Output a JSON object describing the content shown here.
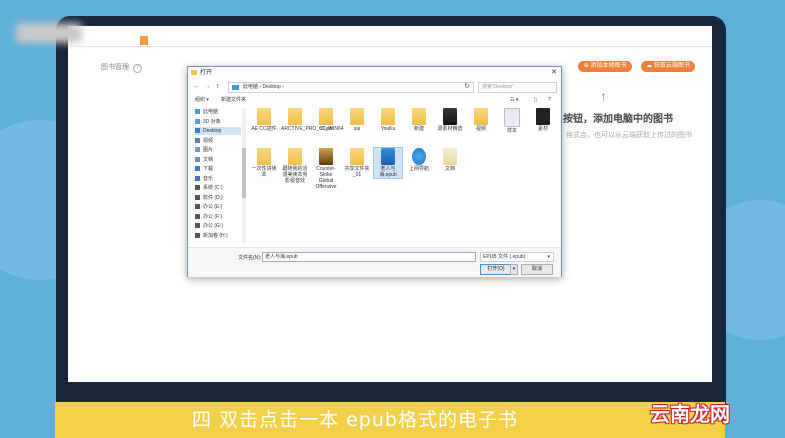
{
  "app": {
    "label": "图书管理",
    "help_icon": "question-icon",
    "btn_add_local": "添加本地图书",
    "btn_cloud": "获取云端图书",
    "prompt_title": "按钮，添加电脑中的图书",
    "prompt_sub": "格式会，也可以从云端获取上传过的图书"
  },
  "dialog": {
    "title": "打开",
    "close": "✕",
    "nav_back": "←",
    "nav_fwd": "→",
    "nav_up": "↑",
    "address": "此电脑 › Desktop ›",
    "refresh": "↻",
    "search_placeholder": "搜索\"Desktop\"",
    "toolbar": {
      "organize": "组织 ▾",
      "new_folder": "新建文件夹",
      "view": "☷ ▾",
      "pane": "▯",
      "help": "?"
    },
    "sidebar": [
      {
        "label": "此电脑",
        "icon": "pc-icon",
        "color": "#3aa0d8"
      },
      {
        "label": "3D 对象",
        "icon": "cube-icon",
        "color": "#5a9fd4"
      },
      {
        "label": "Desktop",
        "icon": "desktop-icon",
        "color": "#3a7dc9",
        "selected": true
      },
      {
        "label": "视频",
        "icon": "video-icon",
        "color": "#6a7fa8"
      },
      {
        "label": "图片",
        "icon": "picture-icon",
        "color": "#6a9fd0"
      },
      {
        "label": "文档",
        "icon": "document-icon",
        "color": "#7a8fb0"
      },
      {
        "label": "下载",
        "icon": "download-icon",
        "color": "#3a7dc9"
      },
      {
        "label": "音乐",
        "icon": "music-icon",
        "color": "#4a70b0"
      },
      {
        "label": "系统 (C:)",
        "icon": "drive-icon",
        "color": "#555"
      },
      {
        "label": "软件 (D:)",
        "icon": "drive-icon",
        "color": "#555"
      },
      {
        "label": "办公 (E:)",
        "icon": "drive-icon",
        "color": "#555"
      },
      {
        "label": "办公 (F:)",
        "icon": "drive-icon",
        "color": "#555"
      },
      {
        "label": "办公 (G:)",
        "icon": "drive-icon",
        "color": "#555"
      },
      {
        "label": "新加卷 (H:)",
        "icon": "drive-icon",
        "color": "#555"
      }
    ],
    "files_row1": [
      {
        "label": "AE CC插件",
        "kind": "folder"
      },
      {
        "label": "ARCTIVE_PRO_C1_WIN64",
        "kind": "folder"
      },
      {
        "label": "oCam",
        "kind": "folder"
      },
      {
        "label": "sai",
        "kind": "folder"
      },
      {
        "label": "YouKu",
        "kind": "folder"
      },
      {
        "label": "新建",
        "kind": "folder"
      },
      {
        "label": "源素材精选",
        "kind": "folder-dark"
      },
      {
        "label": "视频",
        "kind": "folder"
      },
      {
        "label": "样本",
        "kind": "file"
      },
      {
        "label": "素材",
        "kind": "file-dark"
      }
    ],
    "files_row2": [
      {
        "label": "一次性讲读本",
        "kind": "folder"
      },
      {
        "label": "跟随我的活漫美读本身影视音效",
        "kind": "folder"
      },
      {
        "label": "Counter-Strike Global Offensive",
        "kind": "cs"
      },
      {
        "label": "共享文件夹_01",
        "kind": "folder"
      },
      {
        "label": "老人与海.epub",
        "kind": "epub",
        "selected": true
      },
      {
        "label": "上网导航",
        "kind": "ie"
      },
      {
        "label": "文档",
        "kind": "doc"
      }
    ],
    "filename_label": "文件名(N):",
    "filename_value": "老人与海.epub",
    "filetype_value": "EPUB 文件 (.epub)",
    "open_label": "打开(O)",
    "cancel_label": "取消"
  },
  "caption": "四 双击点击一本 epub格式的电子书",
  "watermark": "云南龙网"
}
